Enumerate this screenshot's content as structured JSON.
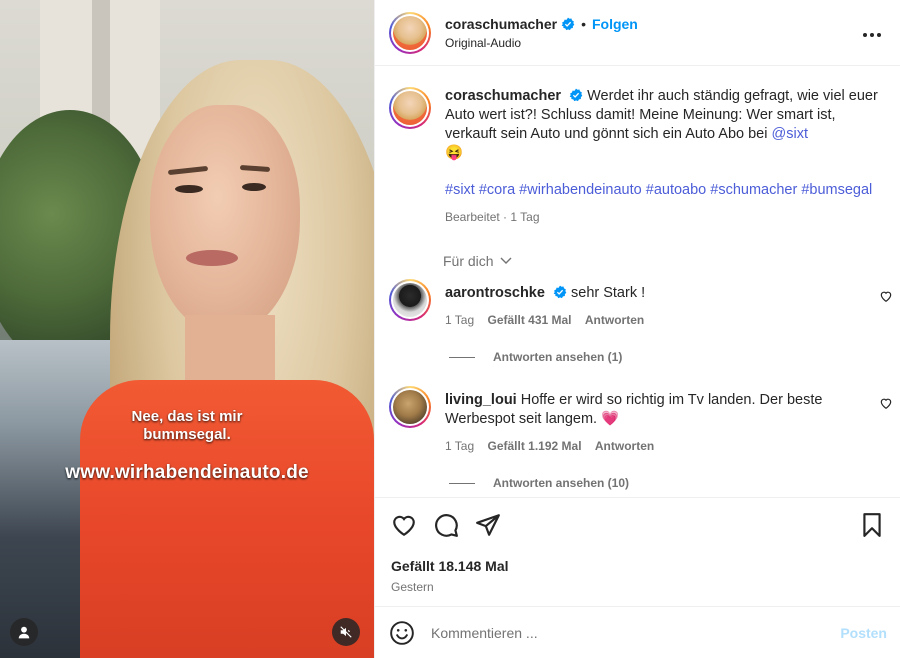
{
  "video": {
    "subtitle_line1": "Nee, das ist mir",
    "subtitle_line2": "bummsegal.",
    "watermark_url": "www.wirhabendeinauto.de"
  },
  "header": {
    "username": "coraschumacher",
    "dot": "•",
    "follow_label": "Folgen",
    "audio": "Original-Audio",
    "more": "•••"
  },
  "caption": {
    "username": "coraschumacher",
    "text_part1": "Werdet ihr auch ständig gefragt, wie viel euer Auto wert ist?! Schluss damit! Meine Meinung: Wer smart ist, verkauft sein Auto und gönnt sich ein Auto Abo bei",
    "mention": "@sixt",
    "emoji": "😝",
    "hashtags": [
      "#sixt",
      "#cora",
      "#wirhabendeinauto",
      "#autoabo",
      "#schumacher",
      "#bumsegal"
    ],
    "meta": "Bearbeitet · 1 Tag"
  },
  "filter": {
    "label": "Für dich"
  },
  "comments": [
    {
      "username": "aarontroschke",
      "verified": true,
      "text": "sehr Stark !",
      "time": "1 Tag",
      "likes": "Gefällt 431 Mal",
      "reply": "Antworten",
      "view_replies": "Antworten ansehen (1)"
    },
    {
      "username": "living_loui",
      "verified": false,
      "text": "Hoffe er wird so richtig im Tv landen. Der beste Werbespot seit langem.",
      "emoji": "💗",
      "time": "1 Tag",
      "likes": "Gefällt 1.192 Mal",
      "reply": "Antworten",
      "view_replies": "Antworten ansehen (10)"
    }
  ],
  "post_footer": {
    "likes": "Gefällt 18.148 Mal",
    "date": "Gestern"
  },
  "composer": {
    "placeholder": "Kommentieren ...",
    "post_label": "Posten"
  },
  "colors": {
    "link": "#4c5dd8",
    "follow": "#0095f6",
    "verified": "#0095f6",
    "post_disabled": "#b2dffc"
  },
  "icons": [
    "verified-badge-icon",
    "more-options-icon",
    "chevron-down-icon",
    "heart-icon",
    "comment-icon",
    "share-icon",
    "bookmark-icon",
    "emoji-icon",
    "user-tag-icon",
    "muted-speaker-icon"
  ]
}
